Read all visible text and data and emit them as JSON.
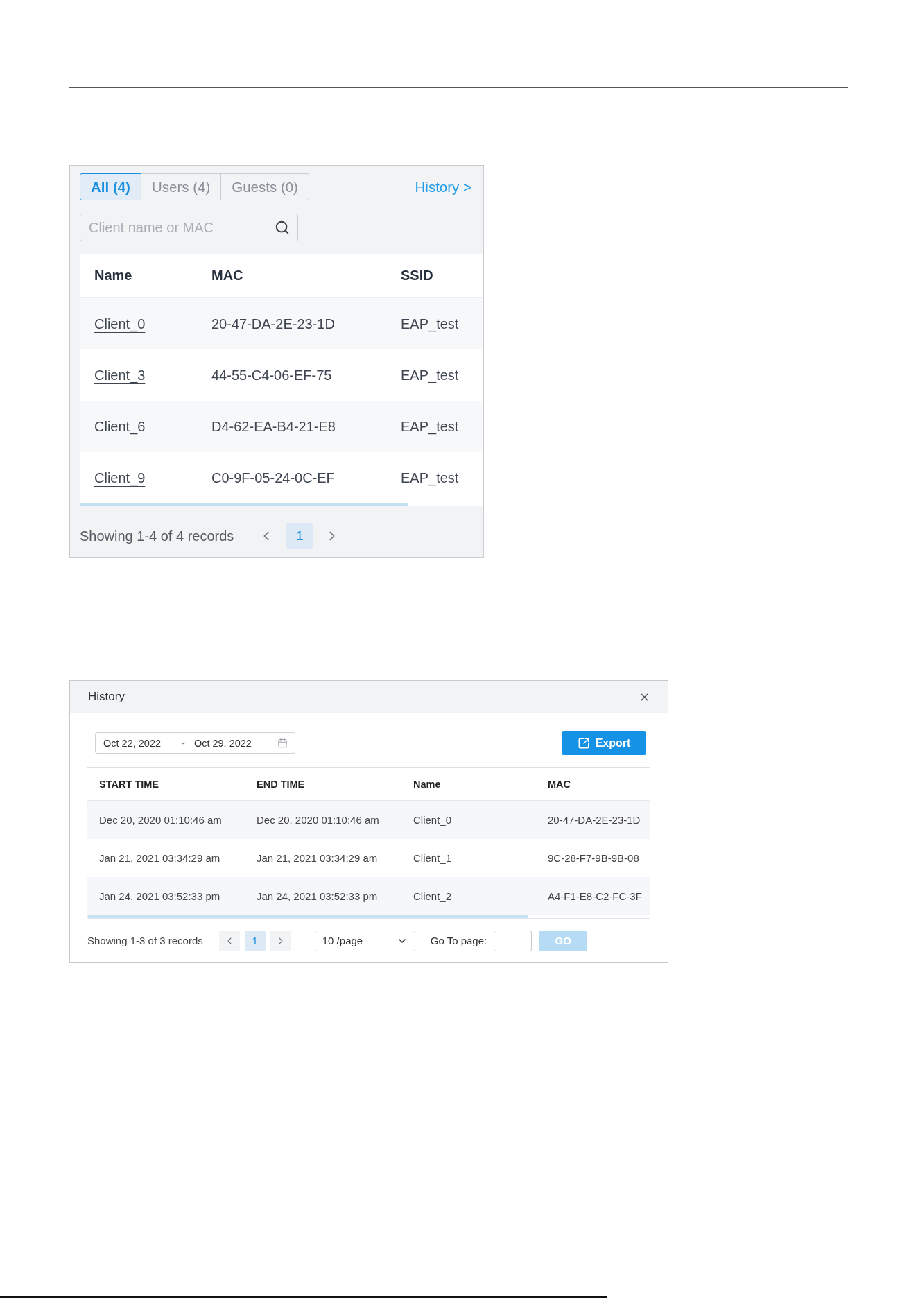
{
  "clients_panel": {
    "tabs": [
      {
        "label": "All (4)",
        "selected": true
      },
      {
        "label": "Users (4)",
        "selected": false
      },
      {
        "label": "Guests (0)",
        "selected": false
      }
    ],
    "history_link": "History >",
    "search": {
      "placeholder": "Client name or MAC"
    },
    "table": {
      "columns": [
        "Name",
        "MAC",
        "SSID"
      ],
      "rows": [
        [
          "Client_0",
          "20-47-DA-2E-23-1D",
          "EAP_test"
        ],
        [
          "Client_3",
          "44-55-C4-06-EF-75",
          "EAP_test"
        ],
        [
          "Client_6",
          "D4-62-EA-B4-21-E8",
          "EAP_test"
        ],
        [
          "Client_9",
          "C0-9F-05-24-0C-EF",
          "EAP_test"
        ]
      ]
    },
    "pagination": {
      "summary": "Showing 1-4 of 4 records",
      "pages": [
        {
          "label": "1",
          "selected": true
        }
      ]
    }
  },
  "history_dialog": {
    "title": "History",
    "date_range": {
      "start": "Oct 22, 2022",
      "separator": "-",
      "end": "Oct 29, 2022"
    },
    "export_button": "Export",
    "table": {
      "columns": [
        "START TIME",
        "END TIME",
        "Name",
        "MAC"
      ],
      "rows": [
        [
          "Dec 20, 2020 01:10:46 am",
          "Dec 20, 2020 01:10:46 am",
          "Client_0",
          "20-47-DA-2E-23-1D"
        ],
        [
          "Jan 21, 2021 03:34:29 am",
          "Jan 21, 2021 03:34:29 am",
          "Client_1",
          "9C-28-F7-9B-9B-08"
        ],
        [
          "Jan 24, 2021 03:52:33 pm",
          "Jan 24, 2021 03:52:33 pm",
          "Client_2",
          "A4-F1-E8-C2-FC-3F"
        ]
      ]
    },
    "pagination": {
      "summary": "Showing 1-3 of 3 records",
      "pages": [
        {
          "label": "1",
          "selected": true
        }
      ],
      "page_size": "10 /page",
      "goto_label": "Go To page:",
      "go_button": {
        "label": "GO",
        "disabled": true
      }
    }
  }
}
